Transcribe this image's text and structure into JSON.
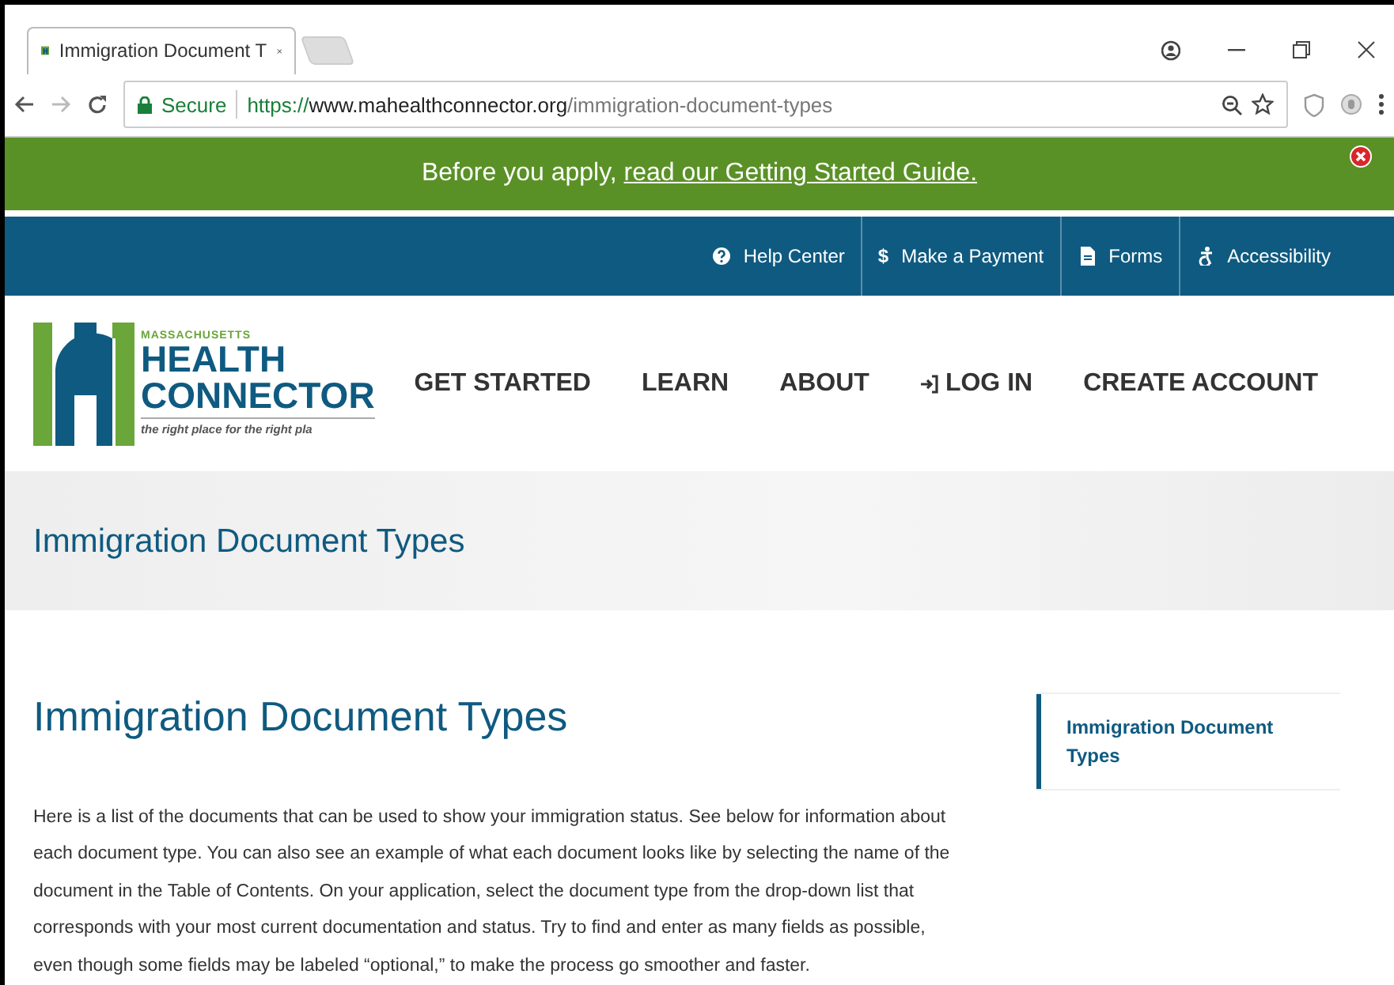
{
  "browser": {
    "tab_title": "Immigration Document T",
    "secure_label": "Secure",
    "url_scheme": "https://",
    "url_host": "www.mahealthconnector.org",
    "url_path": "/immigration-document-types"
  },
  "banner": {
    "text": "Before you apply, ",
    "link": "read our Getting Started Guide."
  },
  "utility_links": [
    {
      "kind": "help",
      "label": "Help Center"
    },
    {
      "kind": "char",
      "glyph": "$",
      "label": "Make a Payment"
    },
    {
      "kind": "document",
      "label": "Forms"
    },
    {
      "kind": "accessibility",
      "label": "Accessibility"
    }
  ],
  "logo": {
    "state": "MASSACHUSETTS",
    "line_1": "HEALTH",
    "line_2": "CONNECTOR",
    "tagline": "the right place for the right pla"
  },
  "main_nav": [
    {
      "kind": "plain",
      "label": "GET STARTED"
    },
    {
      "kind": "plain",
      "label": "LEARN"
    },
    {
      "kind": "plain",
      "label": "ABOUT"
    },
    {
      "kind": "login",
      "label": "LOG IN"
    },
    {
      "kind": "plain",
      "label": "CREATE ACCOUNT"
    }
  ],
  "page_title": "Immigration Document Types",
  "heading": "Immigration Document Types",
  "intro": "Here is a list of the documents that can be used to show your immigration status. See below for information about each document type. You can also see an example of what each document looks like by selecting the name of the document in the Table of Contents. On your application, select the document type from the drop-down list that corresponds with your most current documentation and status. Try to find and enter as many fields as possible, even though some fields may be labeled “optional,” to make the process go smoother and faster.",
  "toc": [
    {
      "label": "Immigration Document Types",
      "selected": true
    }
  ]
}
